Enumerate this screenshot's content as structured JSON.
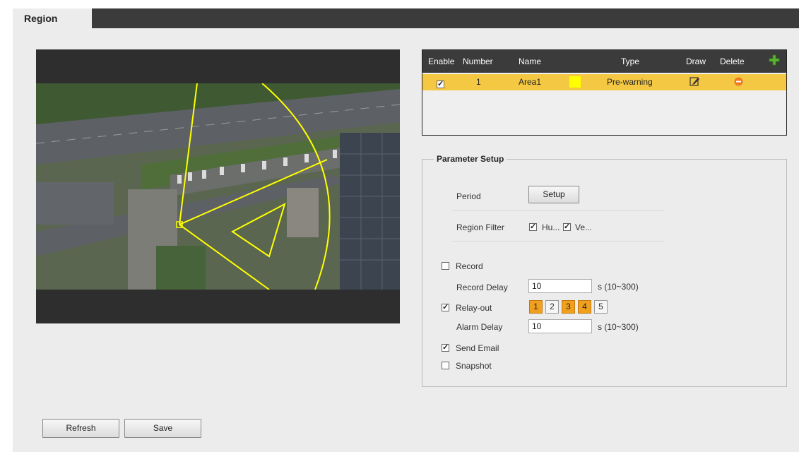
{
  "tab": {
    "label": "Region"
  },
  "table": {
    "headers": {
      "enable": "Enable",
      "number": "Number",
      "name": "Name",
      "type": "Type",
      "draw": "Draw",
      "delete": "Delete"
    },
    "rows": [
      {
        "enabled": true,
        "number": "1",
        "name": "Area1",
        "color": "#ffff00",
        "type": "Pre-warning"
      }
    ]
  },
  "params": {
    "title": "Parameter Setup",
    "period_label": "Period",
    "setup_button": "Setup",
    "region_filter_label": "Region Filter",
    "filter_human": "Hu...",
    "filter_vehicle": "Ve...",
    "record_label": "Record",
    "record_delay_label": "Record Delay",
    "record_delay_value": "10",
    "record_delay_range": "s (10~300)",
    "relay_out_label": "Relay-out",
    "relay_channels": [
      {
        "label": "1",
        "on": true
      },
      {
        "label": "2",
        "on": false
      },
      {
        "label": "3",
        "on": true
      },
      {
        "label": "4",
        "on": true
      },
      {
        "label": "5",
        "on": false
      }
    ],
    "alarm_delay_label": "Alarm Delay",
    "alarm_delay_value": "10",
    "alarm_delay_range": "s (10~300)",
    "send_email_label": "Send Email",
    "snapshot_label": "Snapshot"
  },
  "buttons": {
    "refresh": "Refresh",
    "save": "Save"
  },
  "colors": {
    "accent": "#f4c842",
    "relay_on": "#f0a01e",
    "header": "#3b3b3b",
    "rule_line": "#ffff00"
  }
}
